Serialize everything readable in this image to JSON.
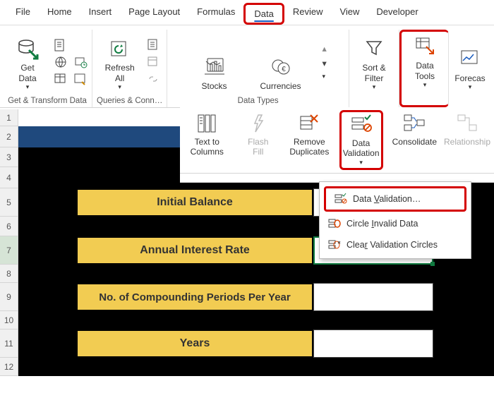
{
  "tabs": {
    "file": "File",
    "home": "Home",
    "insert": "Insert",
    "page_layout": "Page Layout",
    "formulas": "Formulas",
    "data": "Data",
    "review": "Review",
    "view": "View",
    "developer": "Developer"
  },
  "ribbon": {
    "get_data": "Get\nData",
    "refresh_all": "Refresh\nAll",
    "stocks": "Stocks",
    "currencies": "Currencies",
    "sort_filter": "Sort &\nFilter",
    "data_tools": "Data\nTools",
    "forecast": "Forecas",
    "groups": {
      "get_transform": "Get & Transform Data",
      "queries_conn": "Queries & Conn…",
      "data_types": "Data Types"
    }
  },
  "dropdown": {
    "text_to_columns": "Text to\nColumns",
    "flash_fill": "Flash\nFill",
    "remove_duplicates": "Remove\nDuplicates",
    "data_validation": "Data\nValidation",
    "consolidate": "Consolidate",
    "relationships": "Relationship"
  },
  "menu": {
    "data_validation": "Data Validation…",
    "circle_invalid": "Circle Invalid Data",
    "clear_circles": "Clear Validation Circles"
  },
  "rows": [
    "1",
    "2",
    "3",
    "4",
    "5",
    "6",
    "7",
    "8",
    "9",
    "10",
    "11",
    "12"
  ],
  "labels": {
    "initial_balance": "Initial Balance",
    "interest_rate": "Annual Interest Rate",
    "periods": "No. of Compounding Periods Per Year",
    "years": "Years"
  }
}
